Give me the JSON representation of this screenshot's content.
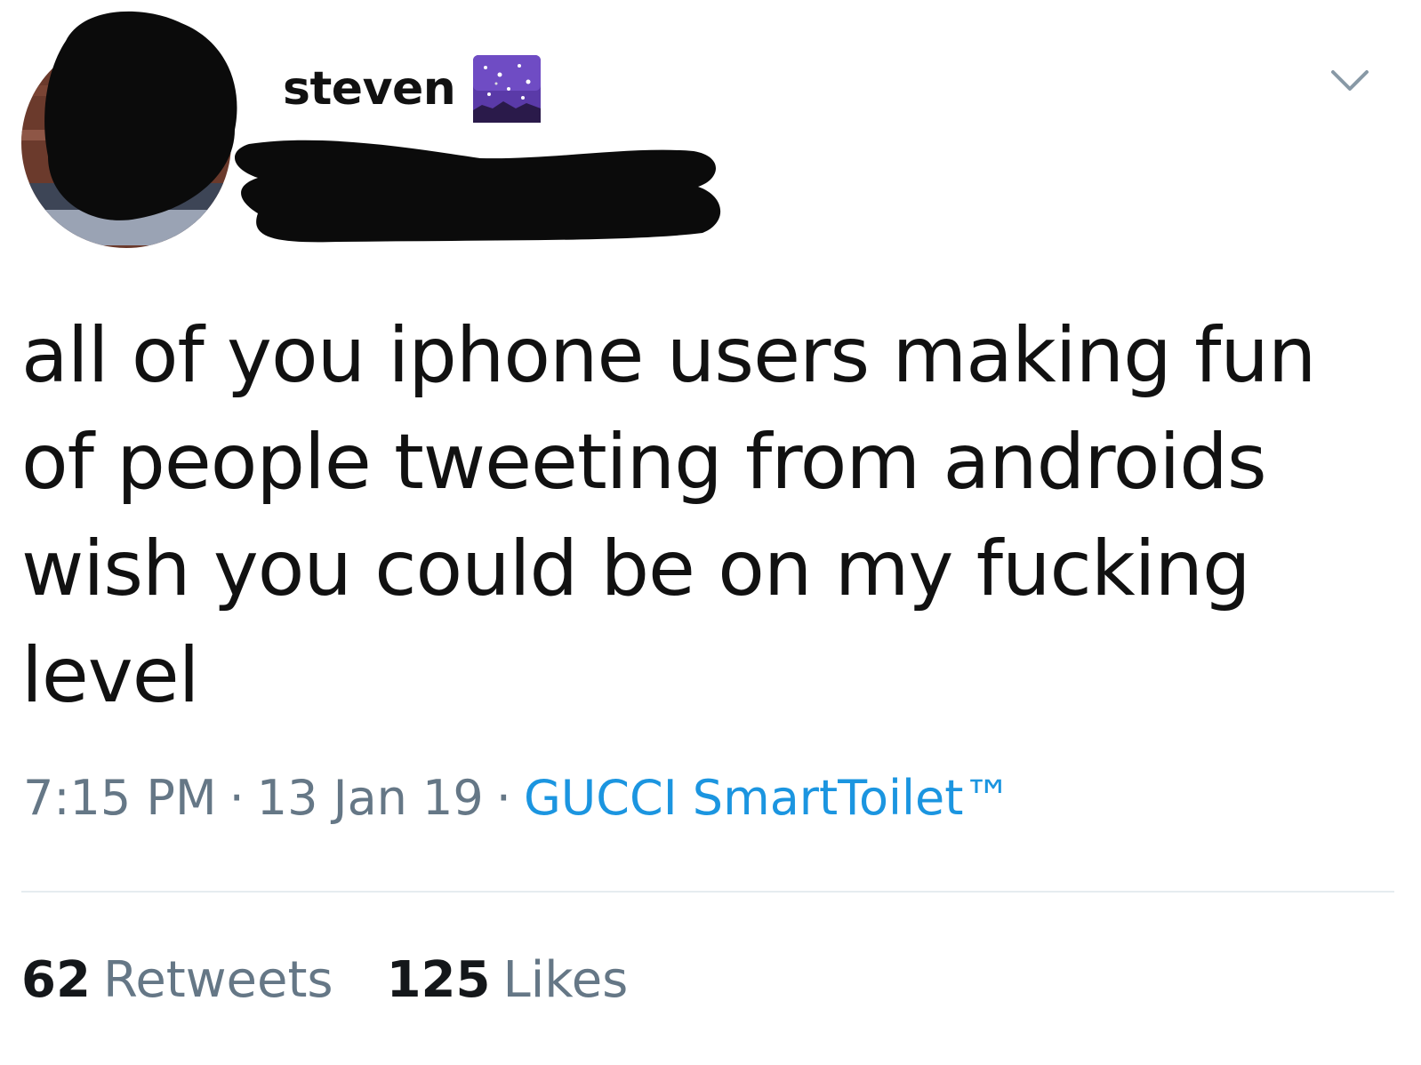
{
  "header": {
    "display_name": "steven",
    "emoji_icon": "night-sky-emoji",
    "menu_icon": "chevron-down-icon"
  },
  "tweet": {
    "text": "all of you iphone users making fun of people tweeting from androids wish you could be on my fucking level"
  },
  "meta": {
    "time": "7:15 PM",
    "separator": "·",
    "date": "13 Jan 19",
    "source": "GUCCI SmartToilet™"
  },
  "stats": {
    "retweets_count": "62",
    "retweets_label": "Retweets",
    "likes_count": "125",
    "likes_label": "Likes"
  },
  "colors": {
    "link": "#1b95e0",
    "muted": "#657786",
    "text": "#14171a"
  }
}
